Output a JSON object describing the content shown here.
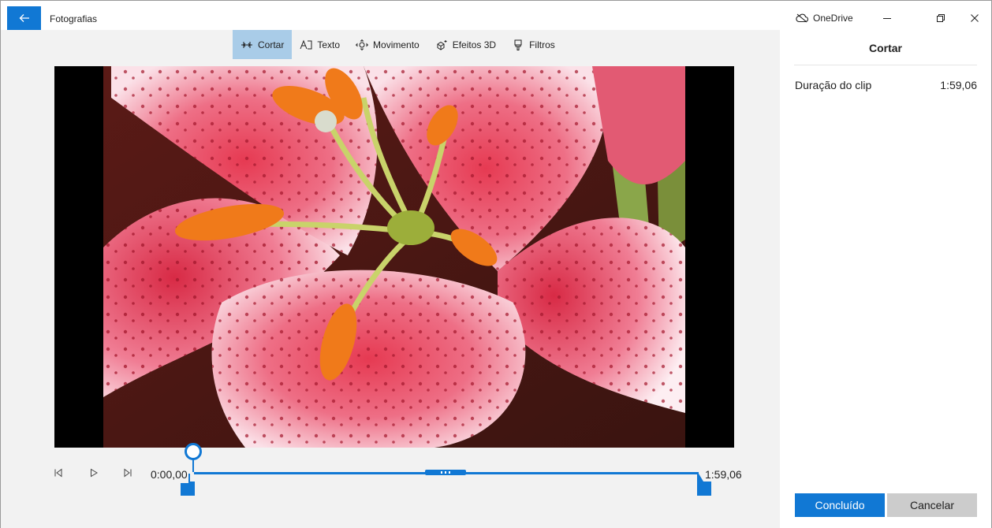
{
  "window": {
    "app_title": "Fotografias",
    "onedrive_label": "OneDrive",
    "icons": [
      "back-arrow-icon",
      "cloud-off-icon",
      "minimize-icon",
      "maximize-icon",
      "close-icon"
    ]
  },
  "toolbar": {
    "items": [
      {
        "label": "Cortar",
        "icon": "trim-icon",
        "active": true
      },
      {
        "label": "Texto",
        "icon": "text-icon",
        "active": false
      },
      {
        "label": "Movimento",
        "icon": "motion-icon",
        "active": false
      },
      {
        "label": "Efeitos 3D",
        "icon": "effects-3d-icon",
        "active": false
      },
      {
        "label": "Filtros",
        "icon": "filter-icon",
        "active": false
      }
    ]
  },
  "playback": {
    "time_start": "0:00,00",
    "time_end": "1:59,06",
    "playhead_fraction": 0.0,
    "trim_start_fraction": 0.0,
    "trim_end_fraction": 1.0
  },
  "panel": {
    "title": "Cortar",
    "duration_label": "Duração do clip",
    "duration_value": "1:59,06",
    "done_label": "Concluído",
    "cancel_label": "Cancelar"
  },
  "colors": {
    "accent": "#1178d4",
    "toolbar_active": "#a9cce8",
    "editor_bg": "#f2f2f2"
  }
}
